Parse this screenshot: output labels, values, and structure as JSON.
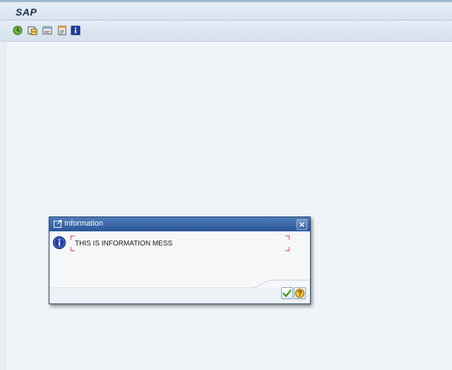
{
  "app": {
    "title": "SAP"
  },
  "toolbar": {
    "buttons": [
      {
        "name": "execute-icon"
      },
      {
        "name": "get-variant-icon"
      },
      {
        "name": "display-list-icon"
      },
      {
        "name": "selection-options-icon"
      },
      {
        "name": "information-icon"
      }
    ]
  },
  "dialog": {
    "title": "Information",
    "message": "THIS IS INFORMATION MESS",
    "icons": {
      "title": "popup-window-icon",
      "message": "info-circle-icon",
      "ok": "checkmark-icon",
      "help": "help-icon",
      "close": "close-icon"
    }
  },
  "colors": {
    "dialog_header": "#2a5699",
    "background": "#eff3f8",
    "ok_green": "#3f9c1a",
    "field_corner": "#e04b4b"
  }
}
